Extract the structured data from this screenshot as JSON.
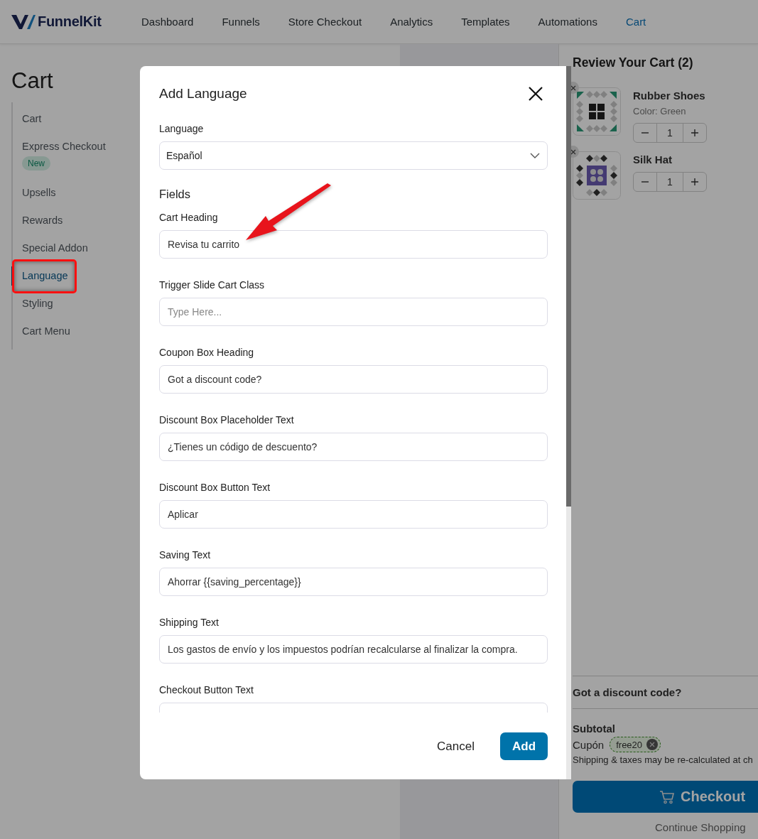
{
  "header": {
    "logo": "FunnelKit",
    "nav": [
      {
        "label": "Dashboard",
        "selected": false
      },
      {
        "label": "Funnels",
        "selected": false
      },
      {
        "label": "Store Checkout",
        "selected": false
      },
      {
        "label": "Analytics",
        "selected": false
      },
      {
        "label": "Templates",
        "selected": false
      },
      {
        "label": "Automations",
        "selected": false
      },
      {
        "label": "Cart",
        "selected": true
      }
    ]
  },
  "page_title": "Cart",
  "sidebar": {
    "items": [
      {
        "label": "Cart",
        "selected": false,
        "highlighted": false
      },
      {
        "label": "Express Checkout",
        "badge": "New",
        "selected": false,
        "highlighted": false
      },
      {
        "label": "Upsells",
        "selected": false,
        "highlighted": false
      },
      {
        "label": "Rewards",
        "selected": false,
        "highlighted": false
      },
      {
        "label": "Special Addon",
        "selected": false,
        "highlighted": false
      },
      {
        "label": "Language",
        "selected": true,
        "highlighted": true
      },
      {
        "label": "Styling",
        "selected": false,
        "highlighted": false
      },
      {
        "label": "Cart Menu",
        "selected": false,
        "highlighted": false
      }
    ]
  },
  "cart_preview": {
    "title": "Review Your Cart (2)",
    "items": [
      {
        "name": "Rubber Shoes",
        "variant": "Color: Green",
        "quantity": "1"
      },
      {
        "name": "Silk Hat",
        "quantity": "1"
      }
    ],
    "discount_heading": "Got a discount code?",
    "subtotal_label": "Subtotal",
    "coupon_label": "Cupón",
    "coupon_code": "free20",
    "shipping_note": "Shipping & taxes may be re-calculated at ch",
    "checkout_button": "Checkout",
    "continue_link": "Continue Shopping"
  },
  "modal": {
    "title": "Add Language",
    "language_label": "Language",
    "language_value": "Español",
    "section_heading": "Fields",
    "fields": [
      {
        "label": "Cart Heading",
        "value": "Revisa tu carrito"
      },
      {
        "label": "Trigger Slide Cart Class",
        "placeholder": "Type Here..."
      },
      {
        "label": "Coupon Box Heading",
        "value": "Got a discount code?"
      },
      {
        "label": "Discount Box Placeholder Text",
        "value": "¿Tienes un código de descuento?"
      },
      {
        "label": "Discount Box Button Text",
        "value": "Aplicar"
      },
      {
        "label": "Saving Text",
        "value": "Ahorrar {{saving_percentage}}"
      },
      {
        "label": "Shipping Text",
        "value": "Los gastos de envío y los impuestos podrían recalcularse al finalizar la compra."
      },
      {
        "label": "Checkout Button Text"
      }
    ],
    "cancel_button": "Cancel",
    "add_button": "Add"
  }
}
